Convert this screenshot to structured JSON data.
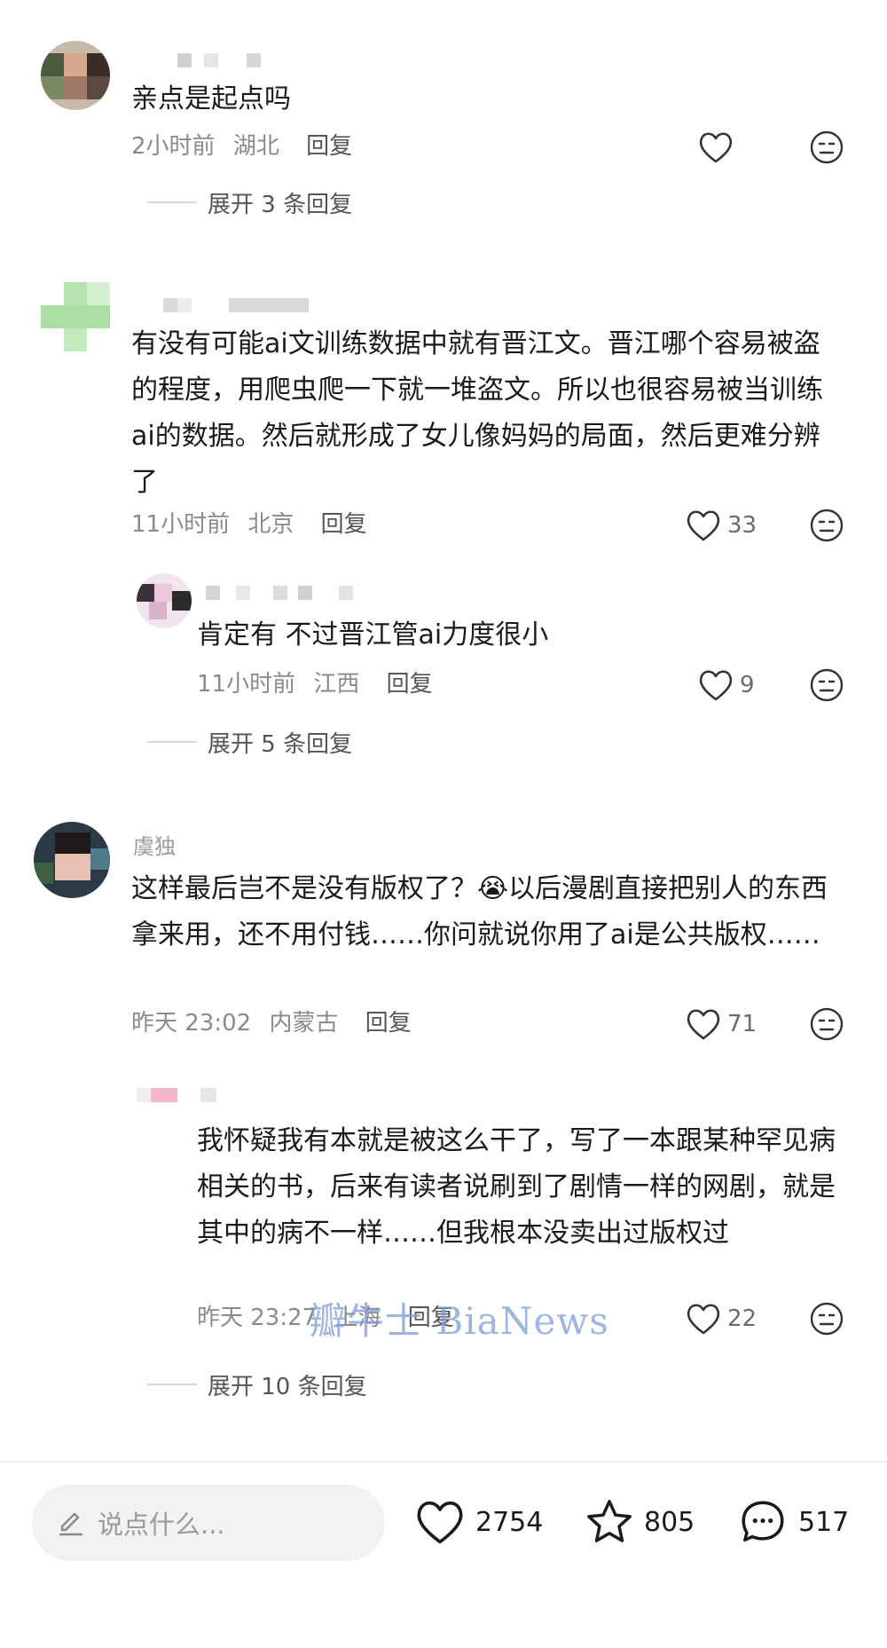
{
  "comments": [
    {
      "text": "亲点是起点吗",
      "meta_time": "2小时前",
      "meta_location": "湖北",
      "reply_label": "回复",
      "likes": "",
      "expand_label": "展开 3 条回复"
    },
    {
      "text": "有没有可能ai文训练数据中就有晋江文。晋江哪个容易被盗的程度，用爬虫爬一下就一堆盗文。所以也很容易被当训练ai的数据。然后就形成了女儿像妈妈的局面，然后更难分辨了",
      "meta_time": "11小时前",
      "meta_location": "北京",
      "reply_label": "回复",
      "likes": "33"
    },
    {
      "text": "肯定有 不过晋江管ai力度很小",
      "meta_time": "11小时前",
      "meta_location": "江西",
      "reply_label": "回复",
      "likes": "9",
      "expand_label": "展开 5 条回复"
    },
    {
      "username": "虞独",
      "text": "这样最后岂不是没有版权了？😭以后漫剧直接把别人的东西拿来用，还不用付钱……你问就说你用了ai是公共版权……",
      "meta_time": "昨天 23:02",
      "meta_location": "内蒙古",
      "reply_label": "回复",
      "likes": "71"
    },
    {
      "text": "我怀疑我有本就是被这么干了，写了一本跟某种罕见病相关的书，后来有读者说刷到了剧情一样的网剧，就是其中的病不一样……但我根本没卖出过版权过",
      "meta_time": "昨天 23:27",
      "meta_location": "上海",
      "reply_label": "回复",
      "likes": "22",
      "expand_label": "展开 10 条回复"
    }
  ],
  "watermark": "瓣牛士 BiaNews",
  "bottom_bar": {
    "input_placeholder": "说点什么...",
    "likes": "2754",
    "favorites": "805",
    "comments": "517"
  },
  "colors": {
    "meta": "#8a8a8a",
    "watermark": "#7e9bd8"
  }
}
